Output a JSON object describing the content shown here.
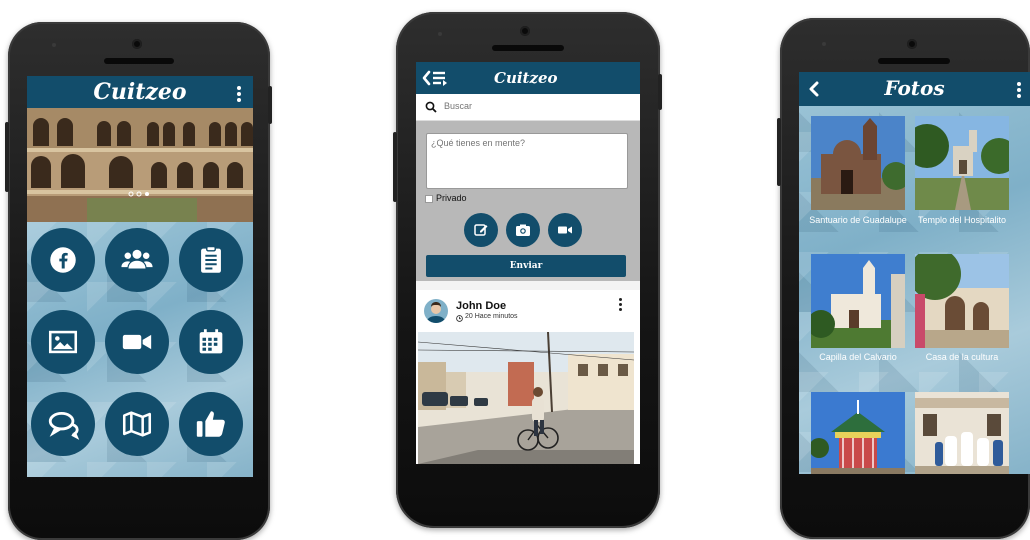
{
  "colors": {
    "primary": "#124d6b",
    "screen_bg": "#f3f3f3"
  },
  "home": {
    "title": "Cuitzeo",
    "menu_icon": "kebab-menu-icon",
    "tiles": [
      {
        "icon": "facebook-icon"
      },
      {
        "icon": "group-icon"
      },
      {
        "icon": "clipboard-icon"
      },
      {
        "icon": "image-icon"
      },
      {
        "icon": "video-camera-icon"
      },
      {
        "icon": "calendar-icon"
      },
      {
        "icon": "chat-icon"
      },
      {
        "icon": "map-icon"
      },
      {
        "icon": "thumbs-up-icon"
      }
    ]
  },
  "feed": {
    "title": "Cuitzeo",
    "back_icon": "back-list-icon",
    "search": {
      "placeholder": "Buscar",
      "value": ""
    },
    "post_input": {
      "placeholder": "¿Qué tienes en mente?",
      "value": ""
    },
    "private_label": "Privado",
    "private_checked": false,
    "actions": [
      {
        "icon": "edit-icon"
      },
      {
        "icon": "camera-icon"
      },
      {
        "icon": "video-icon"
      }
    ],
    "send_label": "Enviar",
    "post": {
      "author": "John Doe",
      "time": "20 Hace minutos"
    }
  },
  "photos": {
    "title": "Fotos",
    "items": [
      {
        "caption": "Santuario de Guadalupe"
      },
      {
        "caption": "Templo del Hospitalito"
      },
      {
        "caption": "Capilla del Calvario"
      },
      {
        "caption": "Casa de la cultura"
      },
      {
        "caption": ""
      },
      {
        "caption": ""
      }
    ]
  }
}
